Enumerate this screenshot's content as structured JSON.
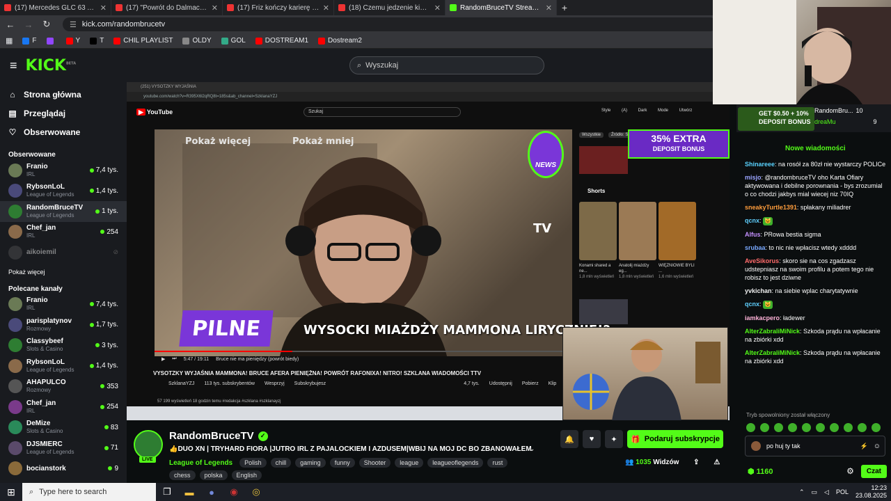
{
  "browser": {
    "tabs": [
      {
        "title": "(17) Mercedes GLC 63 AMG, czy",
        "active": false
      },
      {
        "title": "(17) \"Powrót do Dalmacji\" - RO",
        "active": false
      },
      {
        "title": "(17) Friz kończy karierę influen",
        "active": false
      },
      {
        "title": "(18) Czemu jedzenie kiedyś było",
        "active": false
      },
      {
        "title": "RandomBruceTV Stream - K",
        "active": true
      }
    ],
    "url": "kick.com/randombrucetv",
    "bookmarks": [
      "F",
      "",
      "Y",
      "T",
      "CHIL PLAYLIST",
      "OLDY",
      "GOL",
      "DOSTREAM1",
      "Dostream2"
    ]
  },
  "header": {
    "logo": "KICK",
    "logo_beta": "BETA",
    "search_placeholder": "Wyszukaj"
  },
  "sidebar": {
    "nav": [
      {
        "label": "Strona główna",
        "icon": "home-icon"
      },
      {
        "label": "Przeglądaj",
        "icon": "browse-icon"
      },
      {
        "label": "Obserwowane",
        "icon": "heart-icon"
      }
    ],
    "followed_title": "Obserwowane",
    "followed": [
      {
        "name": "Franio",
        "category": "IRL",
        "viewers": "7,4 tys."
      },
      {
        "name": "RybsonLoL",
        "category": "League of Legends",
        "viewers": "1,4 tys."
      },
      {
        "name": "RandomBruceTV",
        "category": "League of Legends",
        "viewers": "1 tys."
      },
      {
        "name": "Chef_jan",
        "category": "IRL",
        "viewers": "254"
      },
      {
        "name": "aikoiemil",
        "category": "",
        "viewers": ""
      }
    ],
    "show_more": "Pokaż więcej",
    "recommended_title": "Polecane kanały",
    "recommended": [
      {
        "name": "Franio",
        "category": "IRL",
        "viewers": "7,4 tys."
      },
      {
        "name": "parisplatynov",
        "category": "Rozmowy",
        "viewers": "1,7 tys."
      },
      {
        "name": "Classybeef",
        "category": "Slots & Casino",
        "viewers": "3 tys."
      },
      {
        "name": "RybsonLoL",
        "category": "League of Legends",
        "viewers": "1,4 tys."
      },
      {
        "name": "AHAPULCO",
        "category": "Rozmowy",
        "viewers": "353"
      },
      {
        "name": "Chef_jan",
        "category": "IRL",
        "viewers": "254"
      },
      {
        "name": "DeMize",
        "category": "Slots & Casino",
        "viewers": "83"
      },
      {
        "name": "DJSMIERC",
        "category": "League of Legends",
        "viewers": "71"
      },
      {
        "name": "bocianstork",
        "category": "",
        "viewers": "9"
      }
    ]
  },
  "video": {
    "yt_tab": "(251) VYSOTZKY WYJAŚNIA",
    "yt_url": "youtube.com/watch?v=R395X6l2qRQ8t=185s&ab_channel=SzklanaYZJ",
    "yt_search": "Szukaj",
    "yt_menu": "Style (A)  Dark Mode  Utwórz",
    "overlay_show_more": "Pokaż więcej",
    "overlay_show_less": "Pokaż mniej",
    "pilne": "PILNE",
    "lower_title": "WYSOCKI MIAŻDŻY MAMMONA LIRYCZNIE!?",
    "brand_tv": "TV",
    "news_badge": "NEWS",
    "time": "5:47 / 19:11",
    "chapter": "Bruce nie ma pieniędzy (powrót biedy)",
    "yt_video_title": "VYSOTZKY WYJAŚNIA MAMMONA! BRUCE AFERA PIENIĘŻNA! POWRÓT RAFONIXA! NITRO! SZKLANA WIADOMOŚCI TTV",
    "yt_channel": "SzklanaYZJ",
    "yt_subs": "113 tys. subskrybentów",
    "yt_support": "Wesprzyj",
    "yt_subscribed": "Subskrybujesz",
    "yt_likes": "4,7 tys.",
    "yt_share": "Udostępnij",
    "yt_download": "Pobierz",
    "yt_clip": "Klip",
    "yt_stats": "57 199 wyświetleń  18 godzin temu  #redakcja #szklana #szklanayzj",
    "shorts_label": "Shorts",
    "shorts": [
      {
        "title": "Konami shared a ne...",
        "views": "1,8 mln wyświetleń"
      },
      {
        "title": "Anatolij miażdży eg...",
        "views": "1,8 mln wyświetleń"
      },
      {
        "title": "WIĘZNIOWIE BYLI ...",
        "views": "1,6 mln wyświetleń"
      }
    ],
    "promo_top": "35% EXTRA",
    "promo_bottom": "DEPOSIT BONUS",
    "chip_all": "Wszystkie",
    "chip_source": "Źródło: S"
  },
  "stream": {
    "streamer": "RandomBruceTV",
    "live": "LIVE",
    "title": "👍DUO XN | TRYHARD FIORA |JUTRO IRL Z PAJALOCKIEM I AZDUSEM|WBIJ NA MOJ DC BO ZBANOWAŁEM H...",
    "category": "League of Legends",
    "tags": [
      "Polish",
      "chill",
      "gaming",
      "funny",
      "Shooter",
      "league",
      "leagueoflegends",
      "rust",
      "chess",
      "polska",
      "English"
    ],
    "subscribe": "Podaruj subskrypcje",
    "viewers_count": "1035",
    "viewers_label": "Widzów"
  },
  "chat": {
    "banner": "GET $0.50 + 10% DEPOSIT BONUS",
    "supporters": [
      {
        "name": "RandomBru...",
        "count": "10"
      },
      {
        "name": "dreaMu",
        "count": "9"
      }
    ],
    "new_messages": "Nowe wiadomości",
    "messages": [
      {
        "user": "Shinareee",
        "color": "#59d3ff",
        "text": "na rosół za 80zł nie wystarczy POLICe"
      },
      {
        "user": "misjo",
        "color": "#9aa4ff",
        "text": "@randombruceTV oho Karta Ofiary aktywowana i debilne porownania - bys zrozumial o co chodzi jakbys mial wiecej niz 70IQ"
      },
      {
        "user": "sneakyTurtle1391",
        "color": "#ff9d3c",
        "text": "spłakany miliadrer"
      },
      {
        "user": "qcnx",
        "color": "#5fd0ff",
        "text": "😺"
      },
      {
        "user": "Alfus",
        "color": "#c490ff",
        "text": "PRowa bestia sigma"
      },
      {
        "user": "srubaa",
        "color": "#79a9ff",
        "text": "to nic nie wpłacisz wtedy xdddd"
      },
      {
        "user": "AveSikorus",
        "color": "#ff6b6b",
        "text": "skoro sie na cos zgadzasz udstepniasz na swoim profilu a potem tego nie robisz to jest dziwne"
      },
      {
        "user": "yvkichan",
        "color": "#f0f0f0",
        "text": "na siebie wplac charytatywnie"
      },
      {
        "user": "qcnx",
        "color": "#5fd0ff",
        "text": "😺"
      },
      {
        "user": "iamkacpero",
        "color": "#ffb3d9",
        "text": "ładewer"
      },
      {
        "user": "AlterZabraliMiNick",
        "color": "#53fc18",
        "text": "Szkoda prądu na wpłacanie na zbiórki xdd"
      },
      {
        "user": "AlterZabraliMiNick",
        "color": "#53fc18",
        "text": "Szkoda prądu na wpłacanie na zbiórki xdd"
      }
    ],
    "slow_mode": "Tryb spowolniony został włączony",
    "input_value": "po huj ty tak",
    "points": "1160",
    "send": "Czat"
  },
  "taskbar": {
    "search_placeholder": "Type here to search",
    "lang": "POL",
    "time": "12:23",
    "date": "23.08.2025"
  },
  "colors": {
    "accent": "#53fc18",
    "bg": "#0b0e0f",
    "sidebar": "#191b1f"
  }
}
